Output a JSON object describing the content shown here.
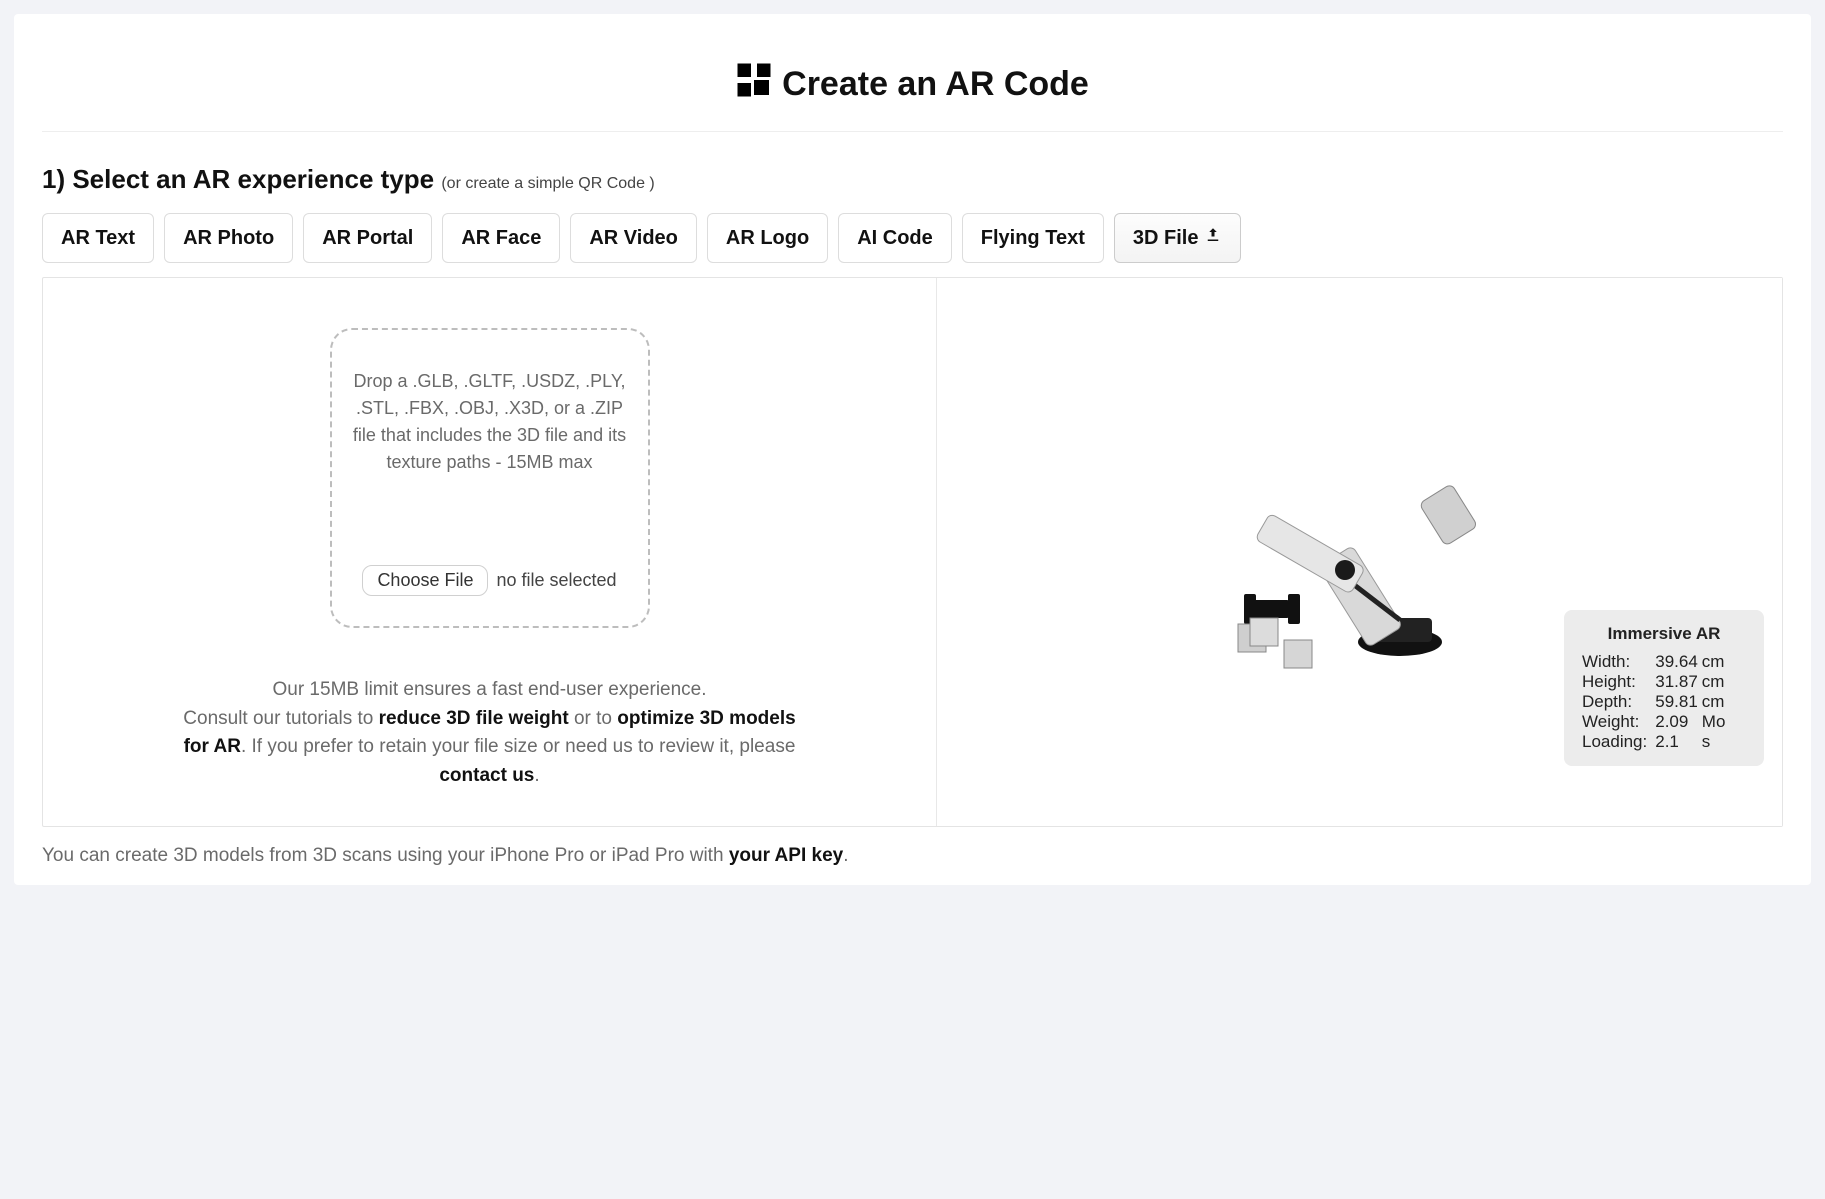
{
  "title": "Create an AR Code",
  "step1": {
    "heading": "1) Select an AR experience type",
    "sublink_prefix": "(or create a simple ",
    "sublink_text": "QR Code",
    "sublink_suffix": " )"
  },
  "tabs": {
    "ar_text": "AR Text",
    "ar_photo": "AR Photo",
    "ar_portal": "AR Portal",
    "ar_face": "AR Face",
    "ar_video": "AR Video",
    "ar_logo": "AR Logo",
    "ai_code": "AI Code",
    "flying_text": "Flying Text",
    "file_3d": "3D File"
  },
  "dropzone_text": "Drop a .GLB, .GLTF, .USDZ, .PLY, .STL, .FBX, .OBJ, .X3D, or a .ZIP file that includes the 3D file and its texture paths - 15MB max",
  "choose_file_label": "Choose File",
  "no_file_label": "no file selected",
  "help": {
    "line1": "Our 15MB limit ensures a fast end-user experience.",
    "line2_pre": "Consult our tutorials to ",
    "line2_bold1": "reduce 3D file weight",
    "line2_mid": " or to ",
    "line2_bold2": "optimize 3D models for AR",
    "line2_post": ". If you prefer to retain your file size or need us to review it, please ",
    "line2_contact": "contact us",
    "line2_end": "."
  },
  "stats": {
    "title": "Immersive AR",
    "rows": [
      {
        "label": "Width:",
        "value": "39.64",
        "unit": "cm"
      },
      {
        "label": "Height:",
        "value": "31.87",
        "unit": "cm"
      },
      {
        "label": "Depth:",
        "value": "59.81",
        "unit": "cm"
      },
      {
        "label": "Weight:",
        "value": "2.09",
        "unit": "Mo"
      },
      {
        "label": "Loading:",
        "value": "2.1",
        "unit": "s"
      }
    ]
  },
  "footer": {
    "pre": "You can create 3D models from 3D scans using your iPhone Pro or iPad Pro with ",
    "link": "your API key",
    "post": "."
  }
}
